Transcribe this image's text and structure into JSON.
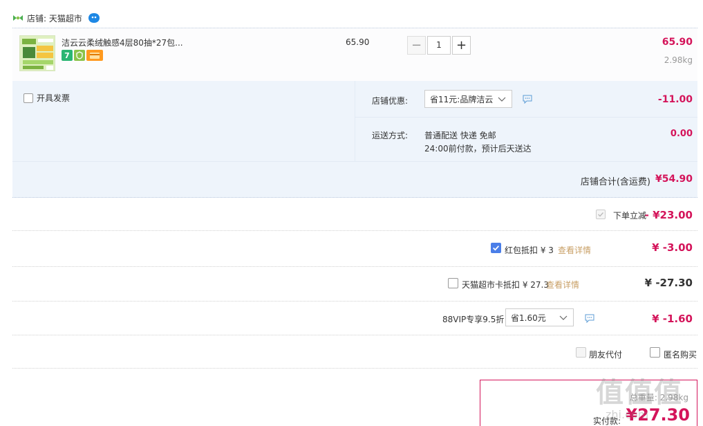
{
  "shop": {
    "label": "店铺: 天猫超市"
  },
  "item": {
    "title": "洁云云柔绒触感4层80抽*27包...",
    "unit_price": "65.90",
    "quantity": "1",
    "line_total": "65.90",
    "weight": "2.98kg"
  },
  "invoice": {
    "label": "开具发票"
  },
  "shop_coupon": {
    "label": "店铺优惠:",
    "selected": "省11元:品牌洁云",
    "amount": "-11.00"
  },
  "shipping": {
    "label": "运送方式:",
    "method": "普通配送 快递 免邮",
    "eta": "24:00前付款，预计后天送达",
    "amount": "0.00"
  },
  "shop_total": {
    "label": "店铺合计(含运费)",
    "amount": "¥54.90"
  },
  "order_discount": {
    "label": "下单立减",
    "amount": "- ¥23.00"
  },
  "red_packet": {
    "label": "红包抵扣 ¥ 3",
    "detail": "查看详情",
    "amount": "¥ -3.00"
  },
  "tmall_card": {
    "label": "天猫超市卡抵扣 ¥ 27.3",
    "detail": "查看详情",
    "amount": "¥ -27.30"
  },
  "vip": {
    "label": "88VIP专享9.5折",
    "selected": "省1.60元",
    "amount": "¥ -1.60"
  },
  "friend_pay": {
    "label": "朋友代付"
  },
  "anonymous": {
    "label": "匿名购买"
  },
  "total": {
    "weight_label": "总重量: 2.98kg",
    "pay_label": "实付款:",
    "pay_amount": "¥27.30"
  },
  "watermark": {
    "main": "值值值",
    "sub": "zhi.com"
  },
  "colors": {
    "accent": "#d4145a",
    "link": "#c9a067",
    "checkbox": "#4a7ee8",
    "panel_bg": "#eef4fb"
  },
  "icons": [
    "shop-logo-icon",
    "wangwang-icon",
    "seven-day-badge-icon",
    "guarantee-badge-icon",
    "card-badge-icon",
    "chevron-down-icon",
    "message-icon",
    "check-icon"
  ]
}
